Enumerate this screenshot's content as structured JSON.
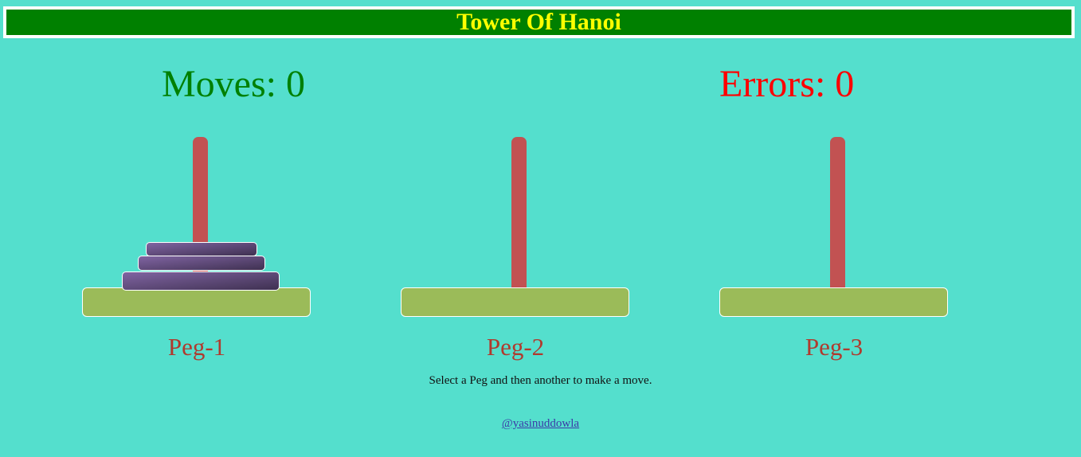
{
  "header": {
    "title": "Tower Of Hanoi"
  },
  "stats": {
    "moves_label": "Moves: 0",
    "errors_label": "Errors: 0"
  },
  "pegs": [
    {
      "label": "Peg-1",
      "disk_count": 3
    },
    {
      "label": "Peg-2",
      "disk_count": 0
    },
    {
      "label": "Peg-3",
      "disk_count": 0
    }
  ],
  "instructions": "Select a Peg and then another to make a move.",
  "credit": {
    "text": "@yasinuddowla"
  },
  "colors": {
    "background": "#54dfcd",
    "header_bg": "#008000",
    "header_text": "#ffff00",
    "moves": "#008000",
    "errors": "#ff0000",
    "rod": "#c25252",
    "base": "#9bbb59",
    "disk": "#8064a2"
  }
}
